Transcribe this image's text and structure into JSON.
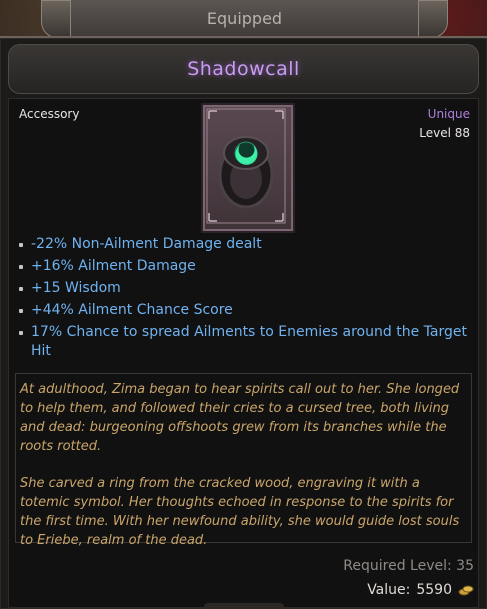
{
  "header": {
    "tab_label": "Equipped"
  },
  "item": {
    "name": "Shadowcall",
    "category": "Accessory",
    "rarity": "Unique",
    "level": "Level 88",
    "image_icon": "ring-icon",
    "affixes": [
      "-22% Non-Ailment Damage dealt",
      "+16% Ailment Damage",
      "+15 Wisdom",
      "+44% Ailment Chance Score",
      "17% Chance to spread Ailments to Enemies around the Target Hit"
    ],
    "lore": [
      "At adulthood, Zima began to hear spirits call out to her. She longed to help them, and followed their cries to a cursed tree, both living and dead: burgeoning offshoots grew from its branches while the roots rotted.",
      "She carved a ring from the cracked wood, engraving it with a totemic symbol. Her thoughts echoed in response to the spirits for the first time. With her newfound ability, she would guide lost souls to Eriebe, realm of the dead."
    ],
    "required_level_label": "Required Level:",
    "required_level_value": "35",
    "value_label": "Value:",
    "value_amount": "5590",
    "currency_icon": "gold-coins-icon"
  },
  "colors": {
    "unique": "#b07fe0",
    "affix": "#6fb2f0",
    "lore": "#c9a56a",
    "title": "#c89bf0"
  }
}
